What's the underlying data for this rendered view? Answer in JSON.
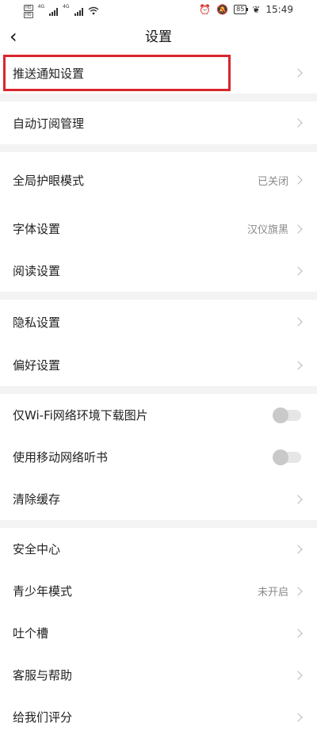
{
  "status_bar": {
    "time": "15:49",
    "battery": "85",
    "sim1": [
      "HD",
      "HD"
    ],
    "net": [
      "4G",
      "4G"
    ]
  },
  "header": {
    "title": "设置"
  },
  "sections": [
    {
      "items": [
        {
          "label": "推送通知设置",
          "value": "",
          "type": "link",
          "highlighted": true
        }
      ]
    },
    {
      "items": [
        {
          "label": "自动订阅管理",
          "value": "",
          "type": "link"
        }
      ]
    },
    {
      "items": [
        {
          "label": "全局护眼模式",
          "value": "已关闭",
          "type": "link"
        },
        {
          "label": "字体设置",
          "value": "汉仪旗黑",
          "type": "link"
        },
        {
          "label": "阅读设置",
          "value": "",
          "type": "link"
        }
      ]
    },
    {
      "items": [
        {
          "label": "隐私设置",
          "value": "",
          "type": "link"
        },
        {
          "label": "偏好设置",
          "value": "",
          "type": "link"
        }
      ]
    },
    {
      "items": [
        {
          "label": "仅Wi-Fi网络环境下载图片",
          "value": "",
          "type": "toggle",
          "on": false
        },
        {
          "label": "使用移动网络听书",
          "value": "",
          "type": "toggle",
          "on": false
        },
        {
          "label": "清除缓存",
          "value": "",
          "type": "link"
        }
      ]
    },
    {
      "items": [
        {
          "label": "安全中心",
          "value": "",
          "type": "link"
        },
        {
          "label": "青少年模式",
          "value": "未开启",
          "type": "link"
        },
        {
          "label": "吐个槽",
          "value": "",
          "type": "link"
        },
        {
          "label": "客服与帮助",
          "value": "",
          "type": "link"
        },
        {
          "label": "给我们评分",
          "value": "",
          "type": "link"
        }
      ]
    }
  ],
  "colors": {
    "highlight": "#d8262e",
    "gap": "#f3f3f3"
  }
}
